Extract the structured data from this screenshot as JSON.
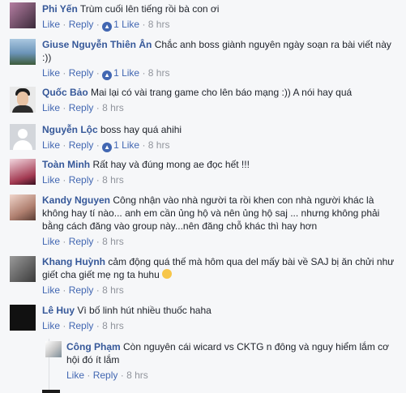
{
  "comments": [
    {
      "author": "Phi Yến",
      "text": "Trùm cuối lên tiếng rồi bà con ơi",
      "like": "Like",
      "reply": "Reply",
      "likes": "1 Like",
      "time": "8 hrs"
    },
    {
      "author": "Giuse Nguyễn Thiên Ân",
      "text": "Chắc anh boss giành nguyên ngày soạn ra bài viết này :))",
      "like": "Like",
      "reply": "Reply",
      "likes": "1 Like",
      "time": "8 hrs"
    },
    {
      "author": "Quốc Bảo",
      "text": "Mai lại có vài trang game cho lên báo mạng :)) A nói hay quá",
      "like": "Like",
      "reply": "Reply",
      "time": "8 hrs"
    },
    {
      "author": "Nguyễn Lộc",
      "text": "boss hay quá ahihi",
      "like": "Like",
      "reply": "Reply",
      "likes": "1 Like",
      "time": "8 hrs"
    },
    {
      "author": "Toàn Minh",
      "text": "Rất hay và đúng mong ae đọc hết !!!",
      "like": "Like",
      "reply": "Reply",
      "time": "8 hrs"
    },
    {
      "author": "Kandy Nguyen",
      "text": "Công nhận vào nhà người ta rồi khen con nhà người khác là không hay tí nào... anh em cần ủng hộ và nên ủng hộ saj ... nhưng không phải bằng cách đăng vào group này...nên đăng chỗ khác thì hay hơn",
      "like": "Like",
      "reply": "Reply",
      "time": "8 hrs"
    },
    {
      "author": "Khang Huỳnh",
      "text": "cảm động quá thế mà hôm qua del mấy bài về SAJ bị ăn chửi như giết cha giết mẹ ng ta huhu",
      "like": "Like",
      "reply": "Reply",
      "time": "8 hrs"
    },
    {
      "author": "Lê Huy",
      "text": "Vì bố linh hút nhiều thuốc haha",
      "like": "Like",
      "reply": "Reply",
      "time": "8 hrs"
    }
  ],
  "reply": {
    "author": "Công Phạm",
    "text": "Còn nguyên cái wicard vs CKTG n đông và nguy hiểm lắm cơ hội đó ít lắm",
    "like": "Like",
    "reply": "Reply",
    "time": "8 hrs"
  },
  "separator": "·"
}
